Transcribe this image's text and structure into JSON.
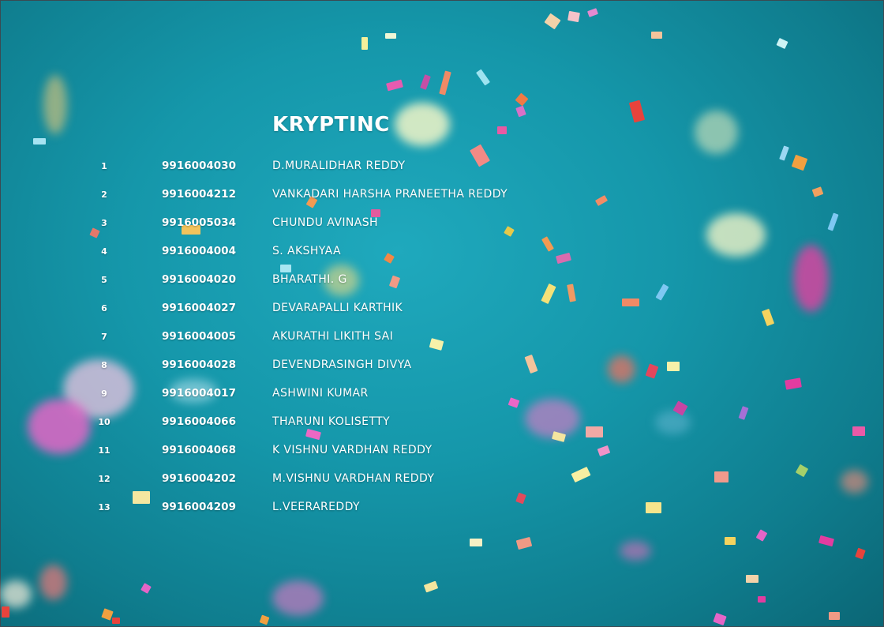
{
  "page": {
    "title": "KRYPTINC",
    "background_color": "#1597aa",
    "text_color": "#ffffff"
  },
  "roster": {
    "rows": [
      {
        "no": "1",
        "id": "9916004030",
        "name": "D.MURALIDHAR REDDY"
      },
      {
        "no": "2",
        "id": "9916004212",
        "name": "VANKADARI HARSHA PRANEETHA REDDY"
      },
      {
        "no": "3",
        "id": "9916005034",
        "name": "CHUNDU AVINASH"
      },
      {
        "no": "4",
        "id": "9916004004",
        "name": "S. AKSHYAA"
      },
      {
        "no": "5",
        "id": "9916004020",
        "name": "BHARATHI. G"
      },
      {
        "no": "6",
        "id": "9916004027",
        "name": "DEVARAPALLI KARTHIK"
      },
      {
        "no": "7",
        "id": "9916004005",
        "name": "AKURATHI LIKITH SAI"
      },
      {
        "no": "8",
        "id": "9916004028",
        "name": "DEVENDRASINGH DIVYA"
      },
      {
        "no": "9",
        "id": "9916004017",
        "name": "ASHWINI KUMAR"
      },
      {
        "no": "10",
        "id": "9916004066",
        "name": "THARUNI KOLISETTY"
      },
      {
        "no": "11",
        "id": "9916004068",
        "name": "K VISHNU VARDHAN REDDY"
      },
      {
        "no": "12",
        "id": "9916004202",
        "name": "M.VISHNU VARDHAN REDDY"
      },
      {
        "no": "13",
        "id": "9916004209",
        "name": "L.VEERAREDDY"
      }
    ]
  }
}
